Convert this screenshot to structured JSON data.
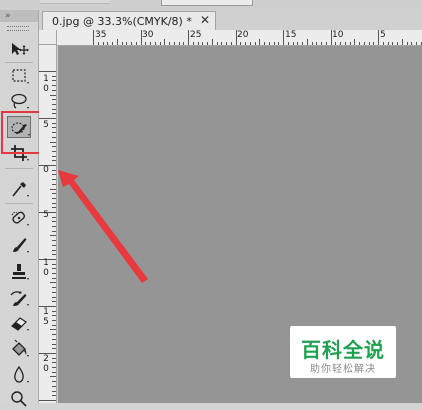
{
  "toolbar": {
    "collapse_glyph": "»",
    "tools": [
      {
        "name": "move-tool-icon",
        "selected": false
      },
      {
        "name": "marquee-tool-icon",
        "selected": false
      },
      {
        "name": "lasso-tool-icon",
        "selected": false
      },
      {
        "name": "quick-selection-tool-icon",
        "selected": true
      },
      {
        "name": "crop-tool-icon",
        "selected": false
      },
      {
        "name": "eyedropper-tool-icon",
        "selected": false
      },
      {
        "name": "spot-healing-brush-tool-icon",
        "selected": false
      },
      {
        "name": "brush-tool-icon",
        "selected": false
      },
      {
        "name": "clone-stamp-tool-icon",
        "selected": false
      },
      {
        "name": "history-brush-tool-icon",
        "selected": false
      },
      {
        "name": "eraser-tool-icon",
        "selected": false
      },
      {
        "name": "paint-bucket-tool-icon",
        "selected": false
      },
      {
        "name": "blur-tool-icon",
        "selected": false
      },
      {
        "name": "dodge-tool-icon",
        "selected": false
      }
    ]
  },
  "document": {
    "tab_title": "0.jpg @ 33.3%(CMYK/8) *",
    "close_glyph": "✕"
  },
  "ruler": {
    "horizontal_labels": [
      "35",
      "30",
      "25",
      "20",
      "15",
      "10",
      "5"
    ],
    "vertical_labels": [
      "10",
      "5",
      "0",
      "5",
      "10",
      "15",
      "20"
    ]
  },
  "annotation": {
    "highlight_color": "#e2383e",
    "arrow_color": "#e8393f"
  },
  "watermark": {
    "main": "百科全说",
    "sub": "助你轻松解决"
  },
  "colors": {
    "canvas": "#959595",
    "toolbar": "#d5d5d5",
    "ruler": "#ececec",
    "watermark_green": "#22a052"
  }
}
